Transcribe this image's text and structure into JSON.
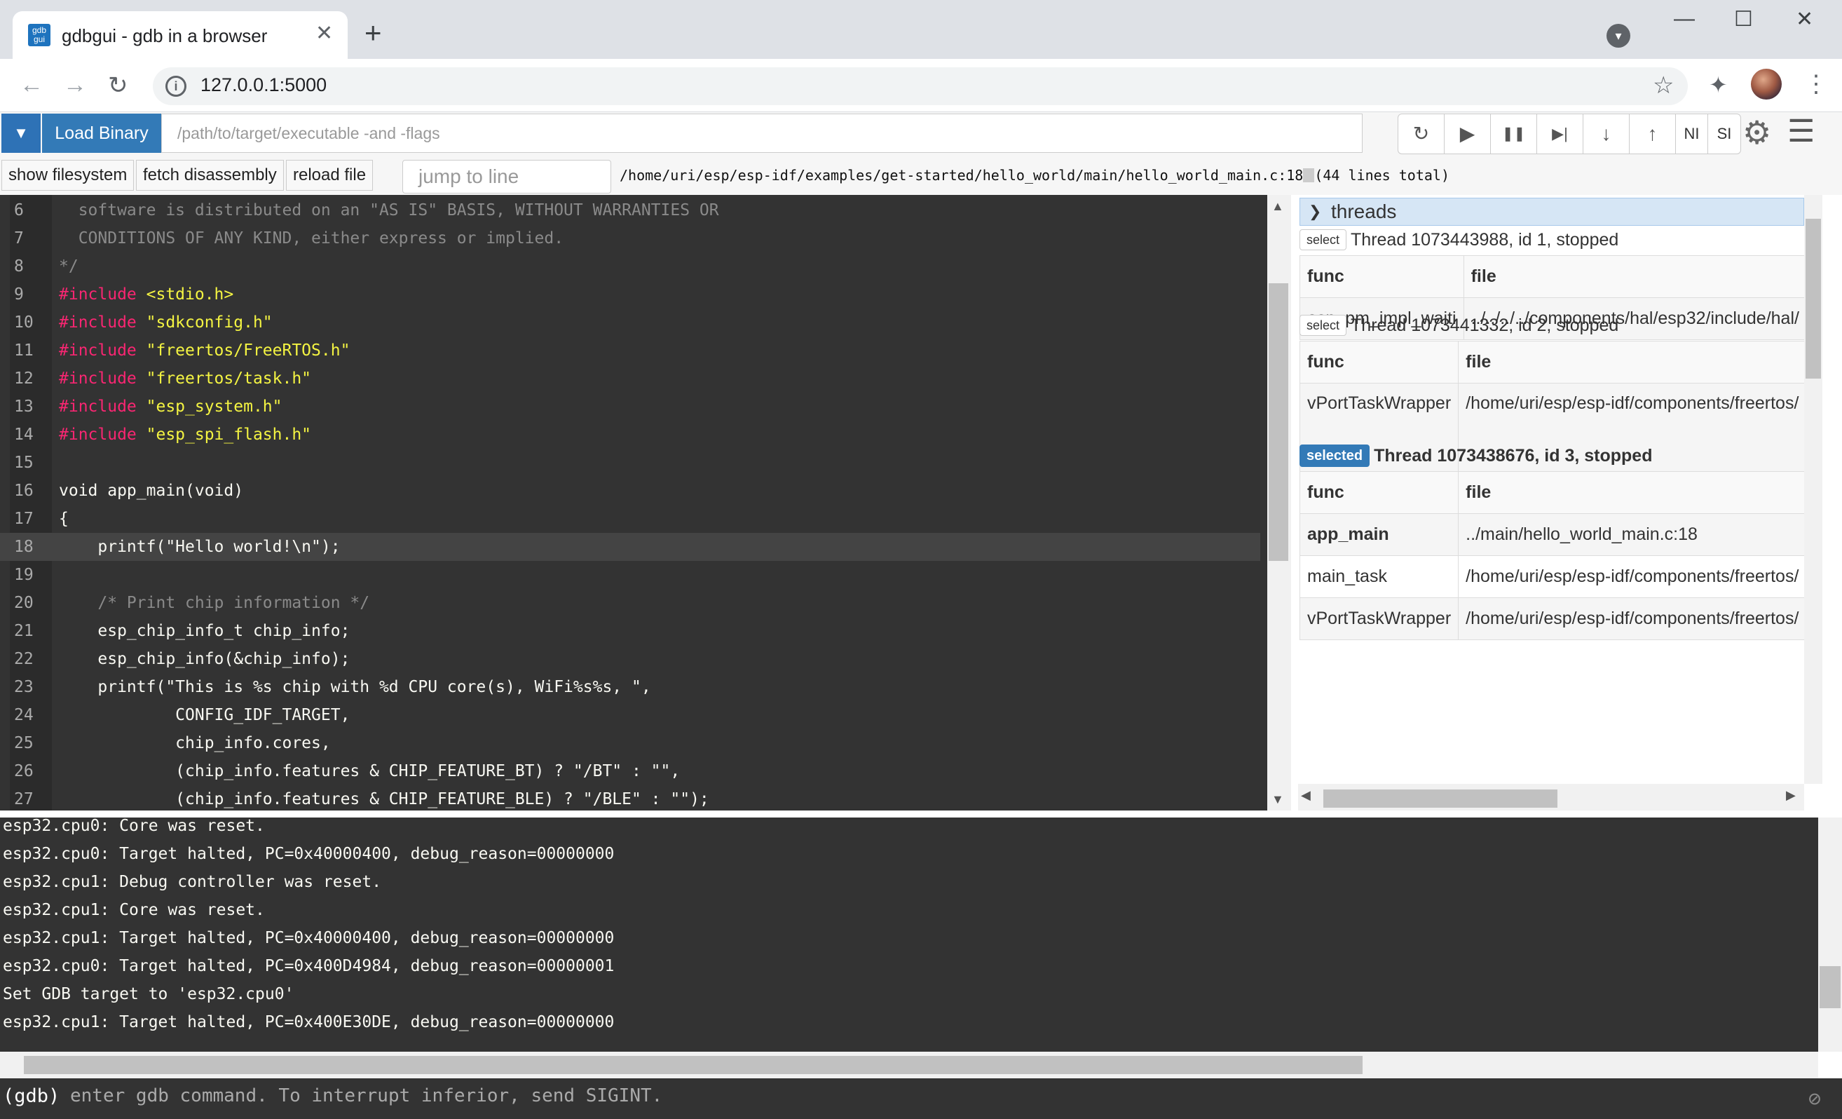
{
  "browser": {
    "tab_title": "gdbgui - gdb in a browser",
    "favicon_text": "gdb gui",
    "url": "127.0.0.1:5000",
    "new_tab": "+",
    "tab_close": "✕"
  },
  "gdbgui": {
    "load_binary": "Load Binary",
    "binary_placeholder": "/path/to/target/executable -and -flags",
    "controls": [
      "↻",
      "▶",
      "❚❚",
      "▶|",
      "↓",
      "↑",
      "NI",
      "SI"
    ],
    "show_filesystem": "show filesystem",
    "fetch_disassembly": "fetch disassembly",
    "reload_file": "reload file",
    "jump_placeholder": "jump to line",
    "file_path": "/home/uri/esp/esp-idf/examples/get-started/hello_world/main/hello_world_main.c:18",
    "lines_total": "(44 lines total)"
  },
  "code_lines": [
    {
      "n": "6",
      "t": "  software is distributed on an \"AS IS\" BASIS, WITHOUT WARRANTIES OR"
    },
    {
      "n": "7",
      "t": "  CONDITIONS OF ANY KIND, either express or implied."
    },
    {
      "n": "8",
      "t": "*/"
    },
    {
      "n": "9",
      "a": "#include",
      "b": " <stdio.h>"
    },
    {
      "n": "10",
      "a": "#include",
      "b": " \"sdkconfig.h\""
    },
    {
      "n": "11",
      "a": "#include",
      "b": " \"freertos/FreeRTOS.h\""
    },
    {
      "n": "12",
      "a": "#include",
      "b": " \"freertos/task.h\""
    },
    {
      "n": "13",
      "a": "#include",
      "b": " \"esp_system.h\""
    },
    {
      "n": "14",
      "a": "#include",
      "b": " \"esp_spi_flash.h\""
    },
    {
      "n": "15",
      "t": ""
    },
    {
      "n": "16",
      "t": "void app_main(void)"
    },
    {
      "n": "17",
      "t": "{"
    },
    {
      "n": "18",
      "t": "    printf(\"Hello world!\\n\");"
    },
    {
      "n": "19",
      "t": ""
    },
    {
      "n": "20",
      "t": "    /* Print chip information */"
    },
    {
      "n": "21",
      "t": "    esp_chip_info_t chip_info;"
    },
    {
      "n": "22",
      "t": "    esp_chip_info(&chip_info);"
    },
    {
      "n": "23",
      "t": "    printf(\"This is %s chip with %d CPU core(s), WiFi%s%s, \","
    },
    {
      "n": "24",
      "t": "            CONFIG_IDF_TARGET,"
    },
    {
      "n": "25",
      "t": "            chip_info.cores,"
    },
    {
      "n": "26",
      "t": "            (chip_info.features & CHIP_FEATURE_BT) ? \"/BT\" : \"\","
    },
    {
      "n": "27",
      "t": "            (chip_info.features & CHIP_FEATURE_BLE) ? \"/BLE\" : \"\");"
    }
  ],
  "threads": {
    "title": "threads",
    "select_label": "select",
    "selected_label": "selected",
    "func_header": "func",
    "file_header": "file",
    "items": [
      {
        "label": "Thread 1073443988, id 1, stopped",
        "frames": [
          {
            "func": "esp_pm_impl_waiti",
            "file": "../../../../components/hal/esp32/include/hal/"
          }
        ]
      },
      {
        "label": "Thread 1073441332, id 2, stopped",
        "frames": [
          {
            "func": "vPortTaskWrapper",
            "file": "/home/uri/esp/esp-idf/components/freertos/"
          }
        ]
      },
      {
        "label": "Thread 1073438676, id 3, stopped",
        "frames": [
          {
            "func": "app_main",
            "file": "../main/hello_world_main.c:18"
          },
          {
            "func": "main_task",
            "file": "/home/uri/esp/esp-idf/components/freertos/"
          },
          {
            "func": "vPortTaskWrapper",
            "file": "/home/uri/esp/esp-idf/components/freertos/"
          }
        ]
      }
    ]
  },
  "console_lines": [
    "esp32.cpu0: Core was reset.",
    "esp32.cpu0: Target halted, PC=0x40000400, debug_reason=00000000",
    "esp32.cpu1: Debug controller was reset.",
    "esp32.cpu1: Core was reset.",
    "esp32.cpu1: Target halted, PC=0x40000400, debug_reason=00000000",
    "esp32.cpu0: Target halted, PC=0x400D4984, debug_reason=00000001",
    "Set GDB target to 'esp32.cpu0'",
    "esp32.cpu1: Target halted, PC=0x400E30DE, debug_reason=00000000"
  ],
  "prompt": {
    "label": "(gdb)",
    "placeholder": "enter gdb command. To interrupt inferior, send SIGINT."
  },
  "colors": {
    "accent": "#337ab7",
    "code_bg": "#333333",
    "keyword": "#f92672",
    "string": "#f4f442"
  }
}
